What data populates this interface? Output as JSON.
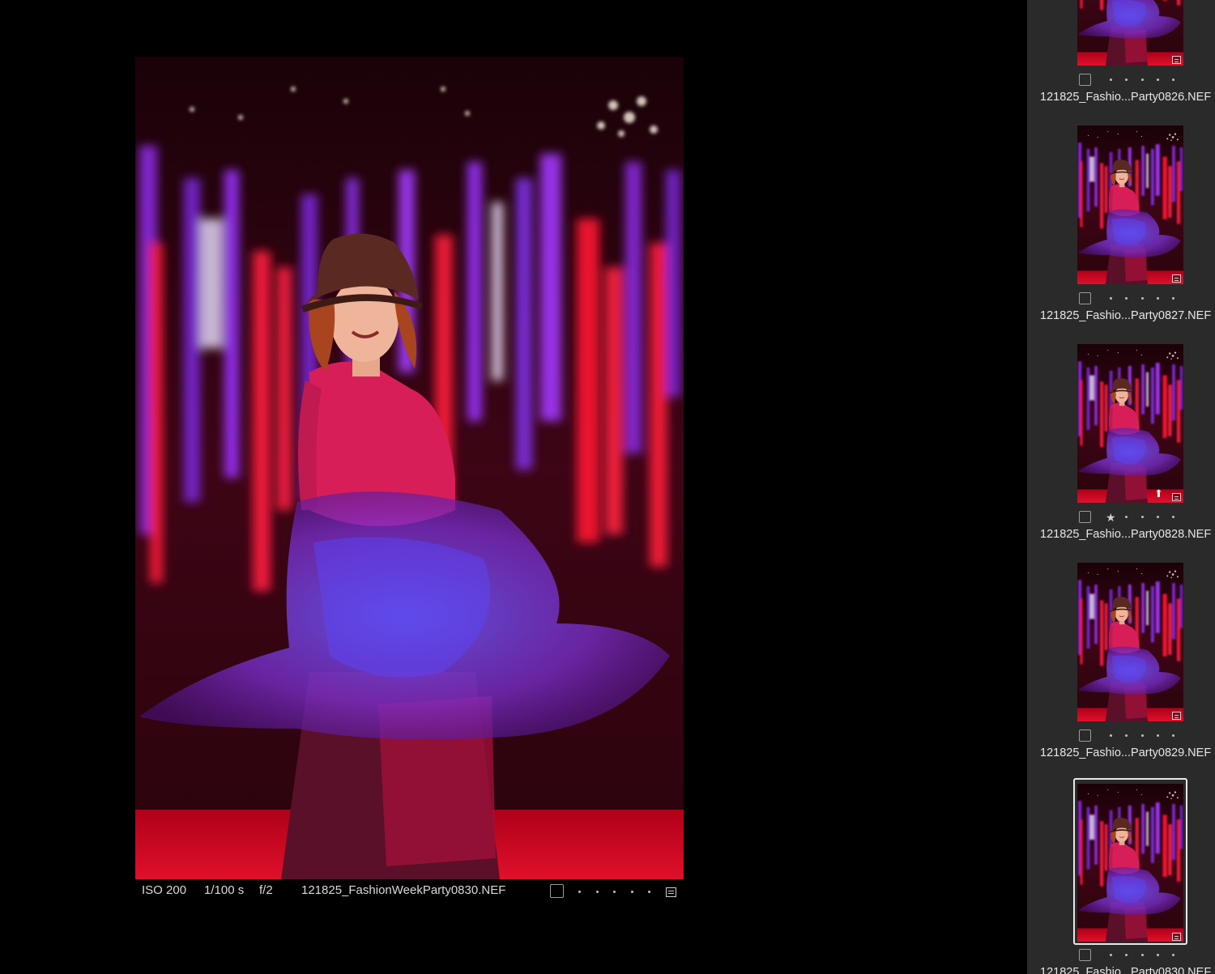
{
  "viewer": {
    "iso": "ISO 200",
    "shutter": "1/100 s",
    "aperture": "f/2",
    "filename": "121825_FashionWeekParty0830.NEF",
    "rating_dots": 5,
    "info_icon": "metadata-badge-icon"
  },
  "filmstrip": {
    "items": [
      {
        "filename": "121825_Fashio...Party0826.NEF",
        "rating": 0,
        "selected": false,
        "uploaded": false
      },
      {
        "filename": "121825_Fashio...Party0827.NEF",
        "rating": 0,
        "selected": false,
        "uploaded": false
      },
      {
        "filename": "121825_Fashio...Party0828.NEF",
        "rating": 1,
        "selected": false,
        "uploaded": true
      },
      {
        "filename": "121825_Fashio...Party0829.NEF",
        "rating": 0,
        "selected": false,
        "uploaded": false
      },
      {
        "filename": "121825_Fashio...Party0830.NEF",
        "rating": 0,
        "selected": true,
        "uploaded": false
      }
    ]
  },
  "colors": {
    "background": "#000000",
    "filmstrip_bg": "#2a2a2a",
    "selection_border": "#e8e8e8",
    "curtain_red": "#ff1a3a",
    "curtain_purple": "#8a2be2"
  }
}
